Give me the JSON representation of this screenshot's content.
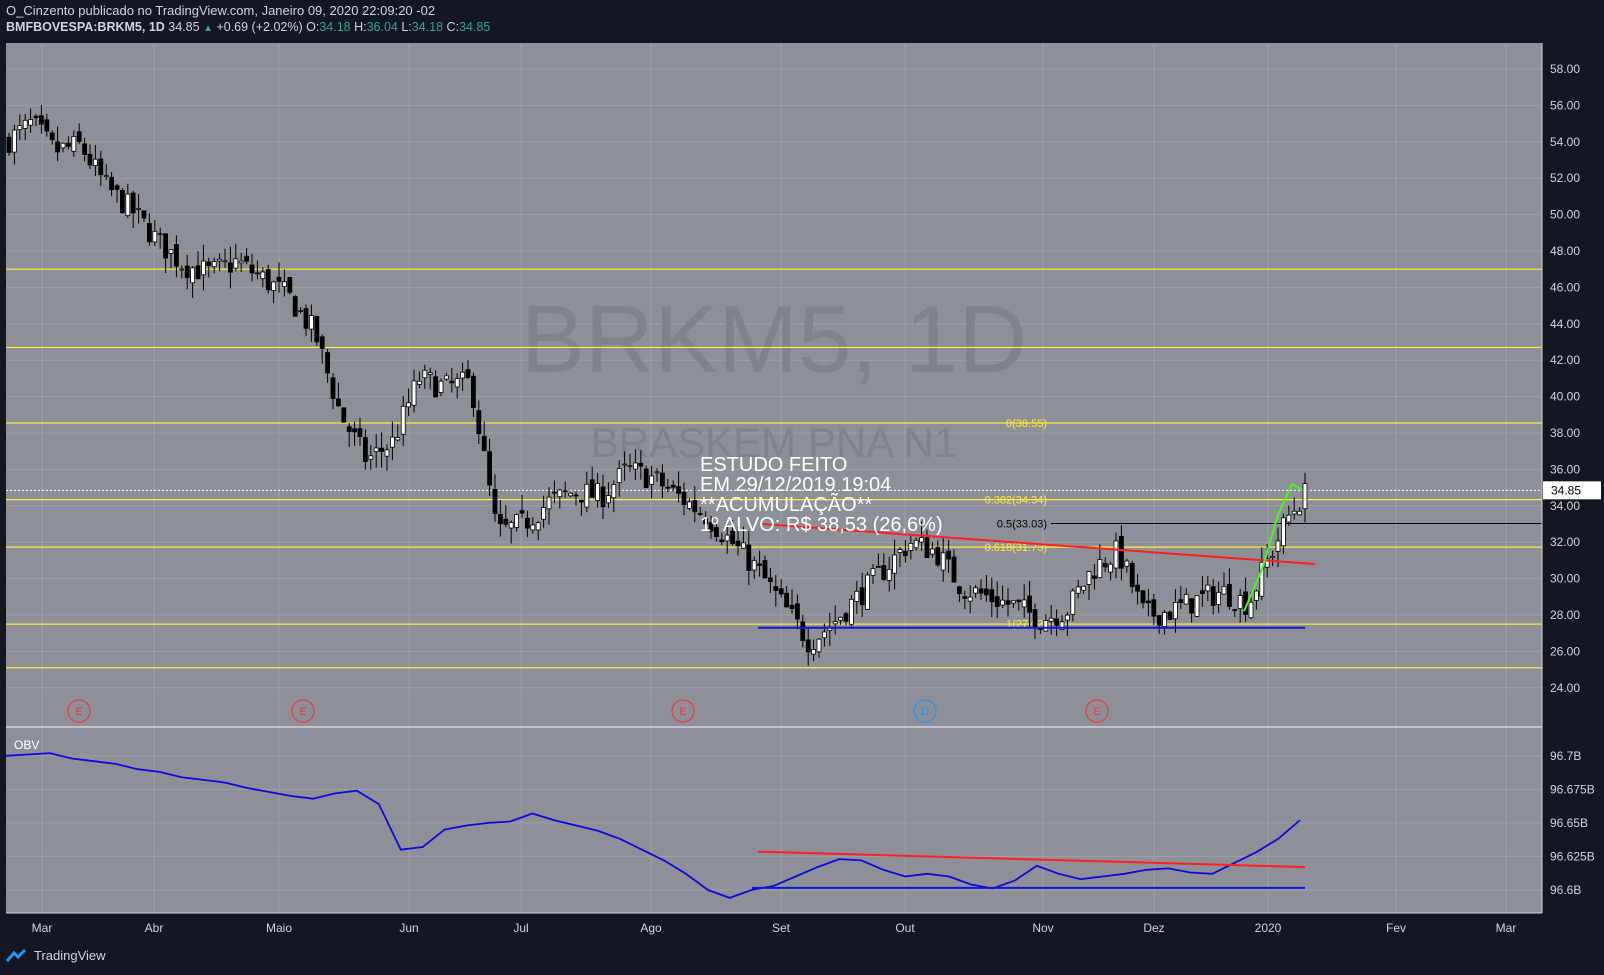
{
  "header": {
    "title_line": "O_Cinzento publicado no TradingView.com, Janeiro 09, 2020 22:09:20 -02",
    "symbol": "BMFBOVESPA:BRKM5, 1D",
    "last": "34.85",
    "change": "+0.69 (+2.02%)",
    "o_label": "O:",
    "o_val": "34.18",
    "h_label": "H:",
    "h_val": "36.04",
    "l_label": "L:",
    "l_val": "34.18",
    "c_label": "C:",
    "c_val": "34.85"
  },
  "watermark": {
    "symbol": "BRKM5, 1D",
    "name": "BRASKEM PNA N1"
  },
  "annotation": [
    "ESTUDO FEITO",
    "EM 29/12/2019 19:04",
    "**ACUMULAÇÃO**",
    "1º ALVO: R$ 38,53 (26,6%)"
  ],
  "footer": {
    "brand": "TradingView"
  },
  "colors": {
    "background": "#131722",
    "plot_bg": "#8e9098",
    "grid": "#9ea0a8",
    "fib": "#ffeb3b",
    "support": "#0b18d9",
    "trend": "#ff1f1f",
    "green": "#39ff14",
    "obv": "#0b0bdd",
    "text": "#d1d4dc"
  },
  "chart_data": [
    {
      "type": "candlestick",
      "ylim": [
        23,
        59
      ],
      "yticks": [
        "58.00",
        "56.00",
        "54.00",
        "52.00",
        "50.00",
        "48.00",
        "46.00",
        "44.00",
        "42.00",
        "40.00",
        "38.00",
        "36.00",
        "34.00",
        "32.00",
        "30.00",
        "28.00",
        "26.00",
        "24.00"
      ],
      "xlabels": [
        "Mar",
        "Abr",
        "Maio",
        "Jun",
        "Jul",
        "Ago",
        "Set",
        "Out",
        "Nov",
        "Dez",
        "2020",
        "Fev",
        "Mar"
      ],
      "last_price": "34.85",
      "horizontal_levels": [
        47.0,
        42.7,
        38.55,
        34.34,
        31.73,
        27.5,
        25.1
      ],
      "fib_labels": [
        {
          "text": "0(38.55)",
          "value": 38.55
        },
        {
          "text": "0.382(34.34)",
          "value": 34.34
        },
        {
          "text": "0.5(33.03)",
          "value": 33.03
        },
        {
          "text": "0.618(31.73)",
          "value": 31.73
        },
        {
          "text": "1(27.52)",
          "value": 27.52
        }
      ],
      "support_line": 27.3,
      "trendline": {
        "from": 33.0,
        "to": 30.8
      },
      "events": [
        "E",
        "E",
        "E",
        "D",
        "E"
      ],
      "price_path": [
        [
          "2019-02-20",
          54.0
        ],
        [
          "2019-02-27",
          55.0
        ],
        [
          "2019-03-05",
          53.5
        ],
        [
          "2019-03-12",
          53.8
        ],
        [
          "2019-03-19",
          51.5
        ],
        [
          "2019-03-26",
          50.2
        ],
        [
          "2019-04-02",
          48.5
        ],
        [
          "2019-04-09",
          47.2
        ],
        [
          "2019-04-16",
          46.8
        ],
        [
          "2019-04-23",
          47.4
        ],
        [
          "2019-04-30",
          46.5
        ],
        [
          "2019-05-07",
          45.5
        ],
        [
          "2019-05-14",
          43.5
        ],
        [
          "2019-05-21",
          39.0
        ],
        [
          "2019-05-28",
          36.5
        ],
        [
          "2019-06-04",
          37.5
        ],
        [
          "2019-06-11",
          41.0
        ],
        [
          "2019-06-18",
          40.5
        ],
        [
          "2019-06-25",
          40.8
        ],
        [
          "2019-07-02",
          32.5
        ],
        [
          "2019-07-09",
          33.0
        ],
        [
          "2019-07-16",
          34.2
        ],
        [
          "2019-07-23",
          34.8
        ],
        [
          "2019-07-30",
          34.5
        ],
        [
          "2019-08-06",
          36.0
        ],
        [
          "2019-08-13",
          35.5
        ],
        [
          "2019-08-20",
          34.5
        ],
        [
          "2019-08-27",
          33.5
        ],
        [
          "2019-09-03",
          32.0
        ],
        [
          "2019-09-10",
          30.5
        ],
        [
          "2019-09-17",
          28.5
        ],
        [
          "2019-09-24",
          26.5
        ],
        [
          "2019-09-30",
          27.5
        ],
        [
          "2019-10-07",
          29.0
        ],
        [
          "2019-10-14",
          30.5
        ],
        [
          "2019-10-21",
          32.0
        ],
        [
          "2019-10-28",
          31.5
        ],
        [
          "2019-11-04",
          29.5
        ],
        [
          "2019-11-11",
          29.0
        ],
        [
          "2019-11-18",
          28.5
        ],
        [
          "2019-11-25",
          27.8
        ],
        [
          "2019-12-02",
          28.2
        ],
        [
          "2019-12-09",
          30.5
        ],
        [
          "2019-12-16",
          31.5
        ],
        [
          "2019-12-23",
          28.0
        ],
        [
          "2019-12-30",
          28.2
        ],
        [
          "2020-01-06",
          28.8
        ],
        [
          "2020-01-13",
          29.3
        ],
        [
          "2020-01-20",
          28.6
        ],
        [
          "2020-01-24",
          30.5
        ],
        [
          "2020-01-31",
          33.5
        ],
        [
          "2020-02-05",
          34.85
        ]
      ]
    },
    {
      "type": "line",
      "name": "OBV",
      "yticks": [
        "96.7B",
        "96.675B",
        "96.65B",
        "96.625B",
        "96.6B"
      ],
      "ylim": [
        96.585,
        96.72
      ],
      "values": [
        96.7,
        96.701,
        96.702,
        96.698,
        96.696,
        96.694,
        96.69,
        96.688,
        96.684,
        96.682,
        96.68,
        96.676,
        96.673,
        96.67,
        96.668,
        96.672,
        96.674,
        96.664,
        96.63,
        96.632,
        96.645,
        96.648,
        96.65,
        96.651,
        96.657,
        96.652,
        96.648,
        96.644,
        96.638,
        96.63,
        96.622,
        96.612,
        96.6,
        96.594,
        96.6,
        96.603,
        96.61,
        96.617,
        96.623,
        96.622,
        96.615,
        96.61,
        96.612,
        96.61,
        96.604,
        96.601,
        96.607,
        96.618,
        96.612,
        96.608,
        96.61,
        96.612,
        96.615,
        96.616,
        96.613,
        96.612,
        96.62,
        96.628,
        96.638,
        96.652
      ],
      "support": 96.6015,
      "resistance_from": 96.6285,
      "resistance_to": 96.617
    }
  ]
}
